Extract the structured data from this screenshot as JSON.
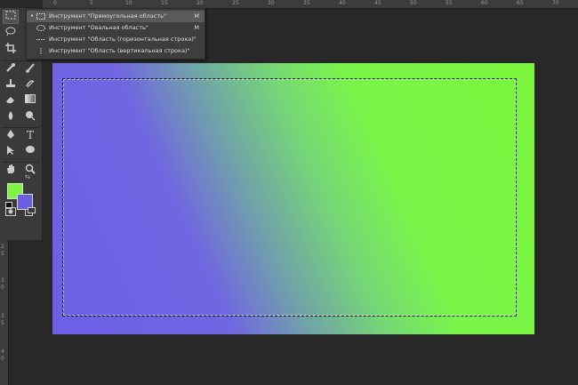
{
  "ruler_top": {
    "labels": [
      "0",
      "5",
      "10",
      "15",
      "20",
      "25",
      "30",
      "35",
      "40",
      "45",
      "50",
      "55",
      "60",
      "65",
      "70"
    ]
  },
  "ruler_left": {
    "labels": [
      "2",
      "5",
      "3",
      "0",
      "3",
      "5",
      "4",
      "0"
    ]
  },
  "toolbar": {
    "tools": [
      "marquee-tool",
      "lasso-tool",
      "crop-tool",
      "eyedropper-tool",
      "brush-tool",
      "healing-tool",
      "clone-stamp-tool",
      "history-brush-tool",
      "eraser-tool",
      "gradient-tool",
      "blur-tool",
      "dodge-tool",
      "pen-tool",
      "type-tool",
      "path-selection-tool",
      "shape-tool",
      "hand-tool",
      "zoom-tool"
    ],
    "foreground_color": "#7bf53f",
    "background_color": "#6a5fe0"
  },
  "flyout": {
    "items": [
      {
        "label": "Инструмент \"Прямоугольная область\"",
        "shortcut": "M",
        "selected": true
      },
      {
        "label": "Инструмент \"Овальная область\"",
        "shortcut": "M",
        "selected": false
      },
      {
        "label": "Инструмент \"Область (горизонтальная строка)\"",
        "shortcut": "",
        "selected": false
      },
      {
        "label": "Инструмент \"Область (вертикальная строка)\"",
        "shortcut": "",
        "selected": false
      }
    ]
  },
  "canvas": {
    "gradient_start": "#6d5fe6",
    "gradient_end": "#7bf63c"
  }
}
